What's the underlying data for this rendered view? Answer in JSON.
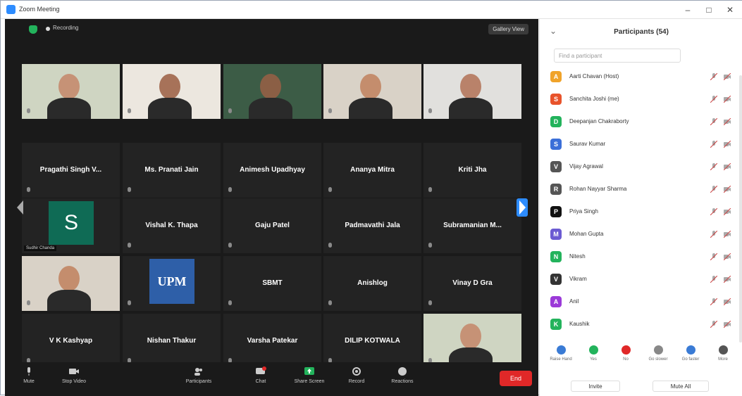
{
  "window": {
    "title": "Zoom Meeting",
    "minimize": "–",
    "maximize": "□",
    "close": "✕"
  },
  "meeting": {
    "recording_text": "Recording",
    "view_label": "Gallery View",
    "tiles": [
      {
        "name": "",
        "caption": "",
        "video": true
      },
      {
        "name": "",
        "caption": "",
        "video": true
      },
      {
        "name": "",
        "caption": "",
        "video": true
      },
      {
        "name": "",
        "caption": "",
        "video": true
      },
      {
        "name": "",
        "caption": "",
        "video": true
      },
      {
        "name": "Pragathi Singh V...",
        "caption": "",
        "video": false
      },
      {
        "name": "Ms. Pranati Jain",
        "caption": "",
        "video": false
      },
      {
        "name": "Animesh Upadhyay",
        "caption": "",
        "video": false
      },
      {
        "name": "Ananya Mitra",
        "caption": "",
        "video": false
      },
      {
        "name": "Kriti Jha",
        "caption": "",
        "video": false
      },
      {
        "name": "S",
        "caption": "Sudhir Chanda",
        "video": false
      },
      {
        "name": "Vishal K. Thapa",
        "caption": "",
        "video": false
      },
      {
        "name": "Gaju Patel",
        "caption": "",
        "video": false
      },
      {
        "name": "Padmavathi Jala",
        "caption": "",
        "video": false
      },
      {
        "name": "Subramanian M...",
        "caption": "",
        "video": false
      },
      {
        "name": "",
        "caption": "",
        "video": true
      },
      {
        "name": "UPM",
        "caption": "",
        "video": false
      },
      {
        "name": "SBMT",
        "caption": "",
        "video": false
      },
      {
        "name": "Anishlog",
        "caption": "",
        "video": false
      },
      {
        "name": "Vinay D Gra",
        "caption": "",
        "video": false
      },
      {
        "name": "V K Kashyap",
        "caption": "",
        "video": false
      },
      {
        "name": "Nishan Thakur",
        "caption": "",
        "video": false
      },
      {
        "name": "Varsha Patekar",
        "caption": "",
        "video": false
      },
      {
        "name": "DILIP KOTWALA",
        "caption": "",
        "video": false
      },
      {
        "name": "",
        "caption": "",
        "video": true
      }
    ],
    "toolbar": {
      "mute": "Mute",
      "stop_video": "Stop Video",
      "participants": "Participants",
      "chat": "Chat",
      "share_screen": "Share Screen",
      "record": "Record",
      "reactions": "Reactions",
      "end": "End"
    }
  },
  "panel": {
    "title": "Participants (54)",
    "search_placeholder": "Find a participant",
    "participants": [
      {
        "initial": "A",
        "name": "Aarti Chavan (Host)",
        "color": "#f0a32a"
      },
      {
        "initial": "S",
        "name": "Sanchita Joshi (me)",
        "color": "#e8532b"
      },
      {
        "initial": "D",
        "name": "Deepanjan Chakraborty",
        "color": "#23b35c"
      },
      {
        "initial": "S",
        "name": "Saurav Kumar",
        "color": "#3b6fd8"
      },
      {
        "initial": "V",
        "name": "Vijay Agrawal",
        "color": "#555555"
      },
      {
        "initial": "R",
        "name": "Rohan Nayyar Sharma",
        "color": "#555555"
      },
      {
        "initial": "P",
        "name": "Priya Singh",
        "color": "#111111"
      },
      {
        "initial": "M",
        "name": "Mohan Gupta",
        "color": "#6b5bd2"
      },
      {
        "initial": "N",
        "name": "Nitesh",
        "color": "#23b35c"
      },
      {
        "initial": "V",
        "name": "Vikram",
        "color": "#333333"
      },
      {
        "initial": "A",
        "name": "Anil",
        "color": "#9b3ad8"
      },
      {
        "initial": "K",
        "name": "Kaushik",
        "color": "#23b35c"
      }
    ],
    "reactions": [
      {
        "label": "Raise Hand",
        "color": "#3a7bd5"
      },
      {
        "label": "Yes",
        "color": "#23b35c"
      },
      {
        "label": "No",
        "color": "#e02828"
      },
      {
        "label": "Go slower",
        "color": "#888888"
      },
      {
        "label": "Go faster",
        "color": "#3a7bd5"
      },
      {
        "label": "More",
        "color": "#555555"
      }
    ],
    "invite": "Invite",
    "mute_all": "Mute All"
  }
}
